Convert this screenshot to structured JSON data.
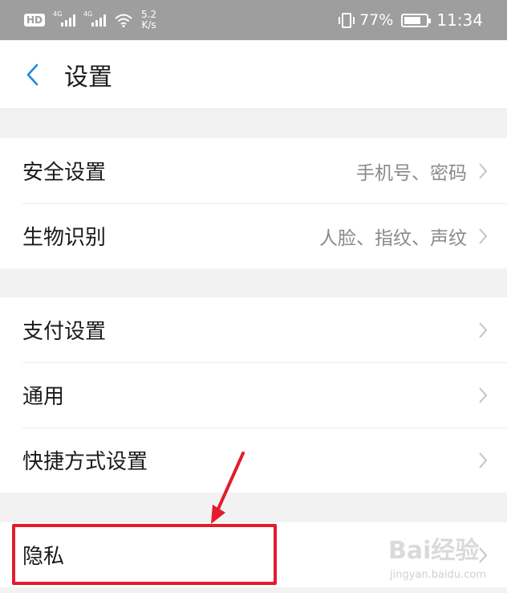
{
  "status_bar": {
    "hd_badge": "HD",
    "network_label_1": "4G",
    "network_label_2": "4G",
    "speed_value": "5.2",
    "speed_unit": "K/s",
    "battery_percent": "77%",
    "battery_level": 0.77,
    "time": "11:34"
  },
  "header": {
    "title": "设置",
    "back_icon": "chevron-left-icon",
    "accent_color": "#1e88e5"
  },
  "groups": [
    {
      "items": [
        {
          "label": "安全设置",
          "value": "手机号、密码"
        },
        {
          "label": "生物识别",
          "value": "人脸、指纹、声纹"
        }
      ]
    },
    {
      "items": [
        {
          "label": "支付设置",
          "value": ""
        },
        {
          "label": "通用",
          "value": ""
        },
        {
          "label": "快捷方式设置",
          "value": ""
        }
      ]
    },
    {
      "items": [
        {
          "label": "隐私",
          "value": ""
        }
      ]
    }
  ],
  "annotation": {
    "color": "#e31d2b",
    "target": "隐私"
  },
  "watermark": {
    "main": "Bai经验",
    "sub": "jingyan.baidu.com"
  }
}
